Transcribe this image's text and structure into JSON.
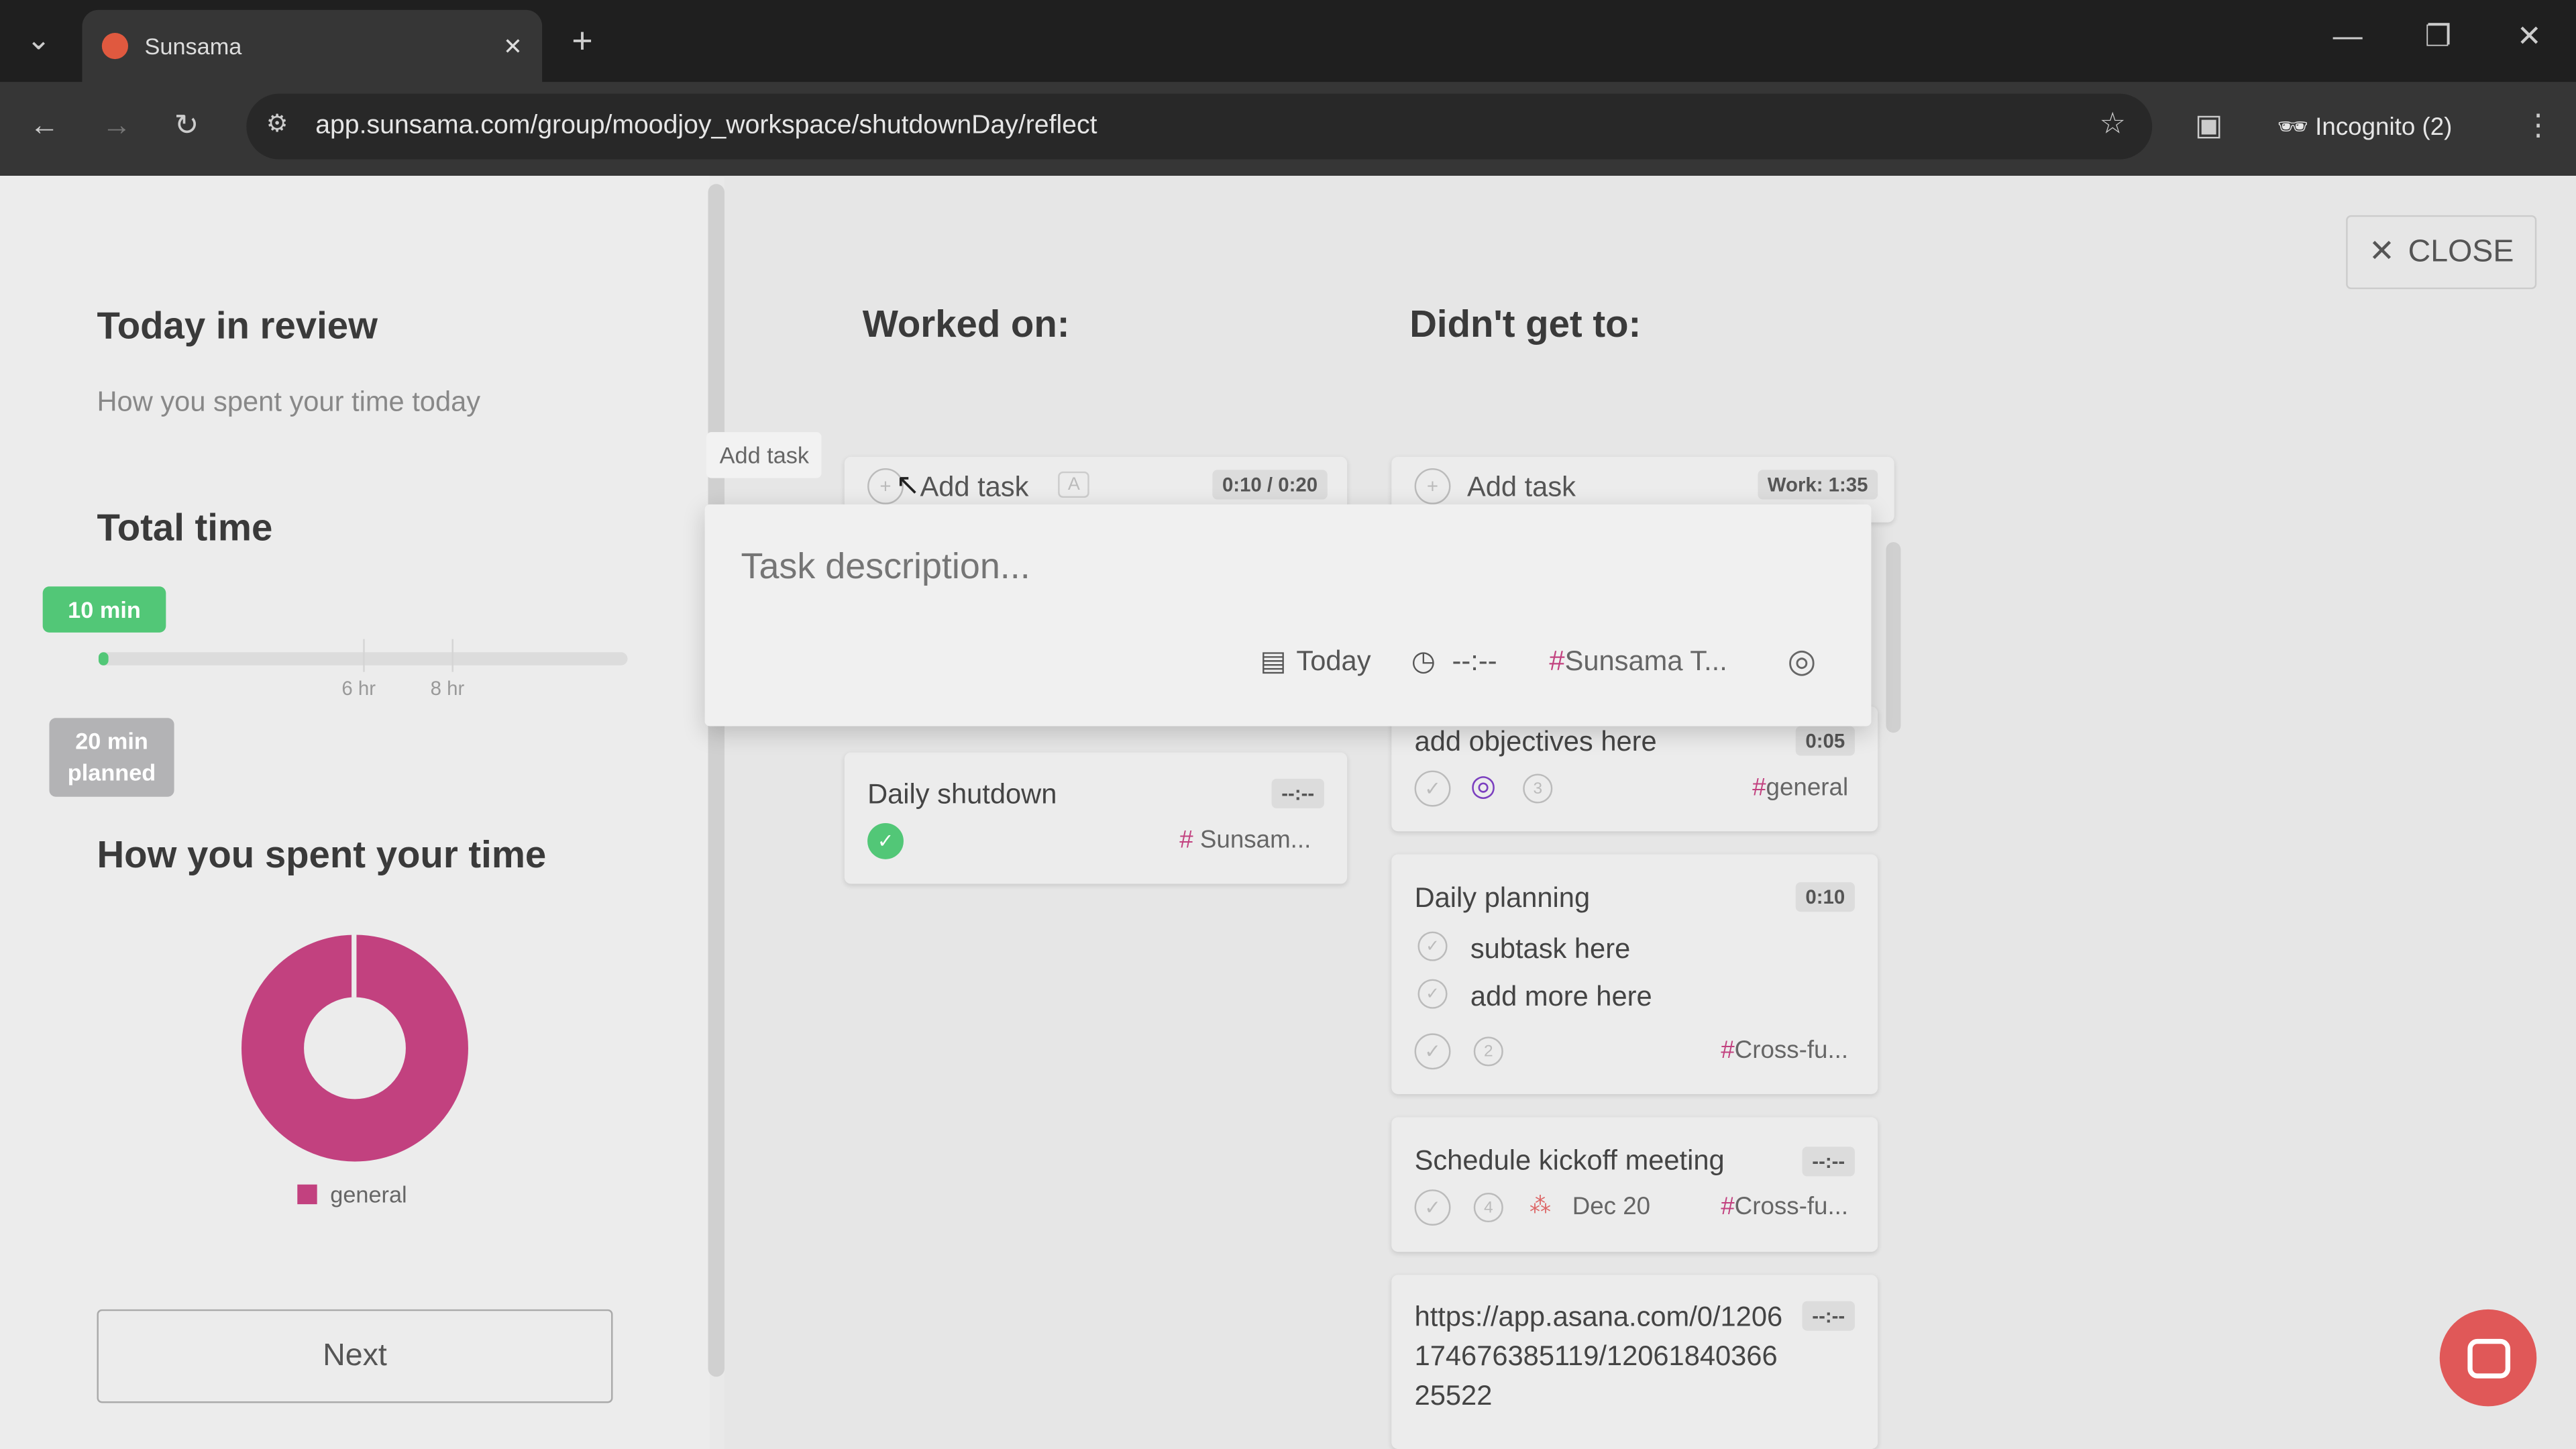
{
  "browser": {
    "tab_title": "Sunsama",
    "url": "app.sunsama.com/group/moodjoy_workspace/shutdownDay/reflect",
    "profile": "Incognito (2)"
  },
  "left": {
    "title": "Today in review",
    "subtitle": "How you spent your time today",
    "total_time_title": "Total time",
    "actual_label": "10 min",
    "planned_label_1": "20 min",
    "planned_label_2": "planned",
    "tick_6": "6 hr",
    "tick_8": "8 hr",
    "actual_fraction": 0.02,
    "spent_title": "How you spent your time",
    "legend": "general",
    "legend_color": "#c2417f",
    "next": "Next"
  },
  "main": {
    "close": "CLOSE",
    "worked_title": "Worked on:",
    "didnt_title": "Didn't get to:",
    "tooltip": "Add task",
    "add_task": "Add task",
    "add_task_key": "A",
    "worked_time": "0:10 / 0:20",
    "didnt_time": "Work: 1:35",
    "modal": {
      "placeholder": "Task description...",
      "date": "Today",
      "time": "--:--",
      "channel": "Sunsama T..."
    },
    "worked_tasks": [
      {
        "title": "Daily shutdown",
        "time": "--:--",
        "channel": "Sunsam..."
      }
    ],
    "didnt_tasks": [
      {
        "title": "add objectives here",
        "time": "0:05",
        "subtask_count": "3",
        "channel": "general"
      },
      {
        "title": "Daily planning",
        "time": "0:10",
        "subtasks": [
          "subtask here",
          "add more here"
        ],
        "subtask_count": "2",
        "channel": "Cross-fu..."
      },
      {
        "title": "Schedule kickoff meeting",
        "time": "--:--",
        "subtask_count": "4",
        "date": "Dec 20",
        "channel": "Cross-fu..."
      },
      {
        "title_lines": [
          "https://app.asana.com/0/1206",
          "174676385119/12061840366",
          "25522"
        ],
        "time": "--:--"
      }
    ]
  }
}
